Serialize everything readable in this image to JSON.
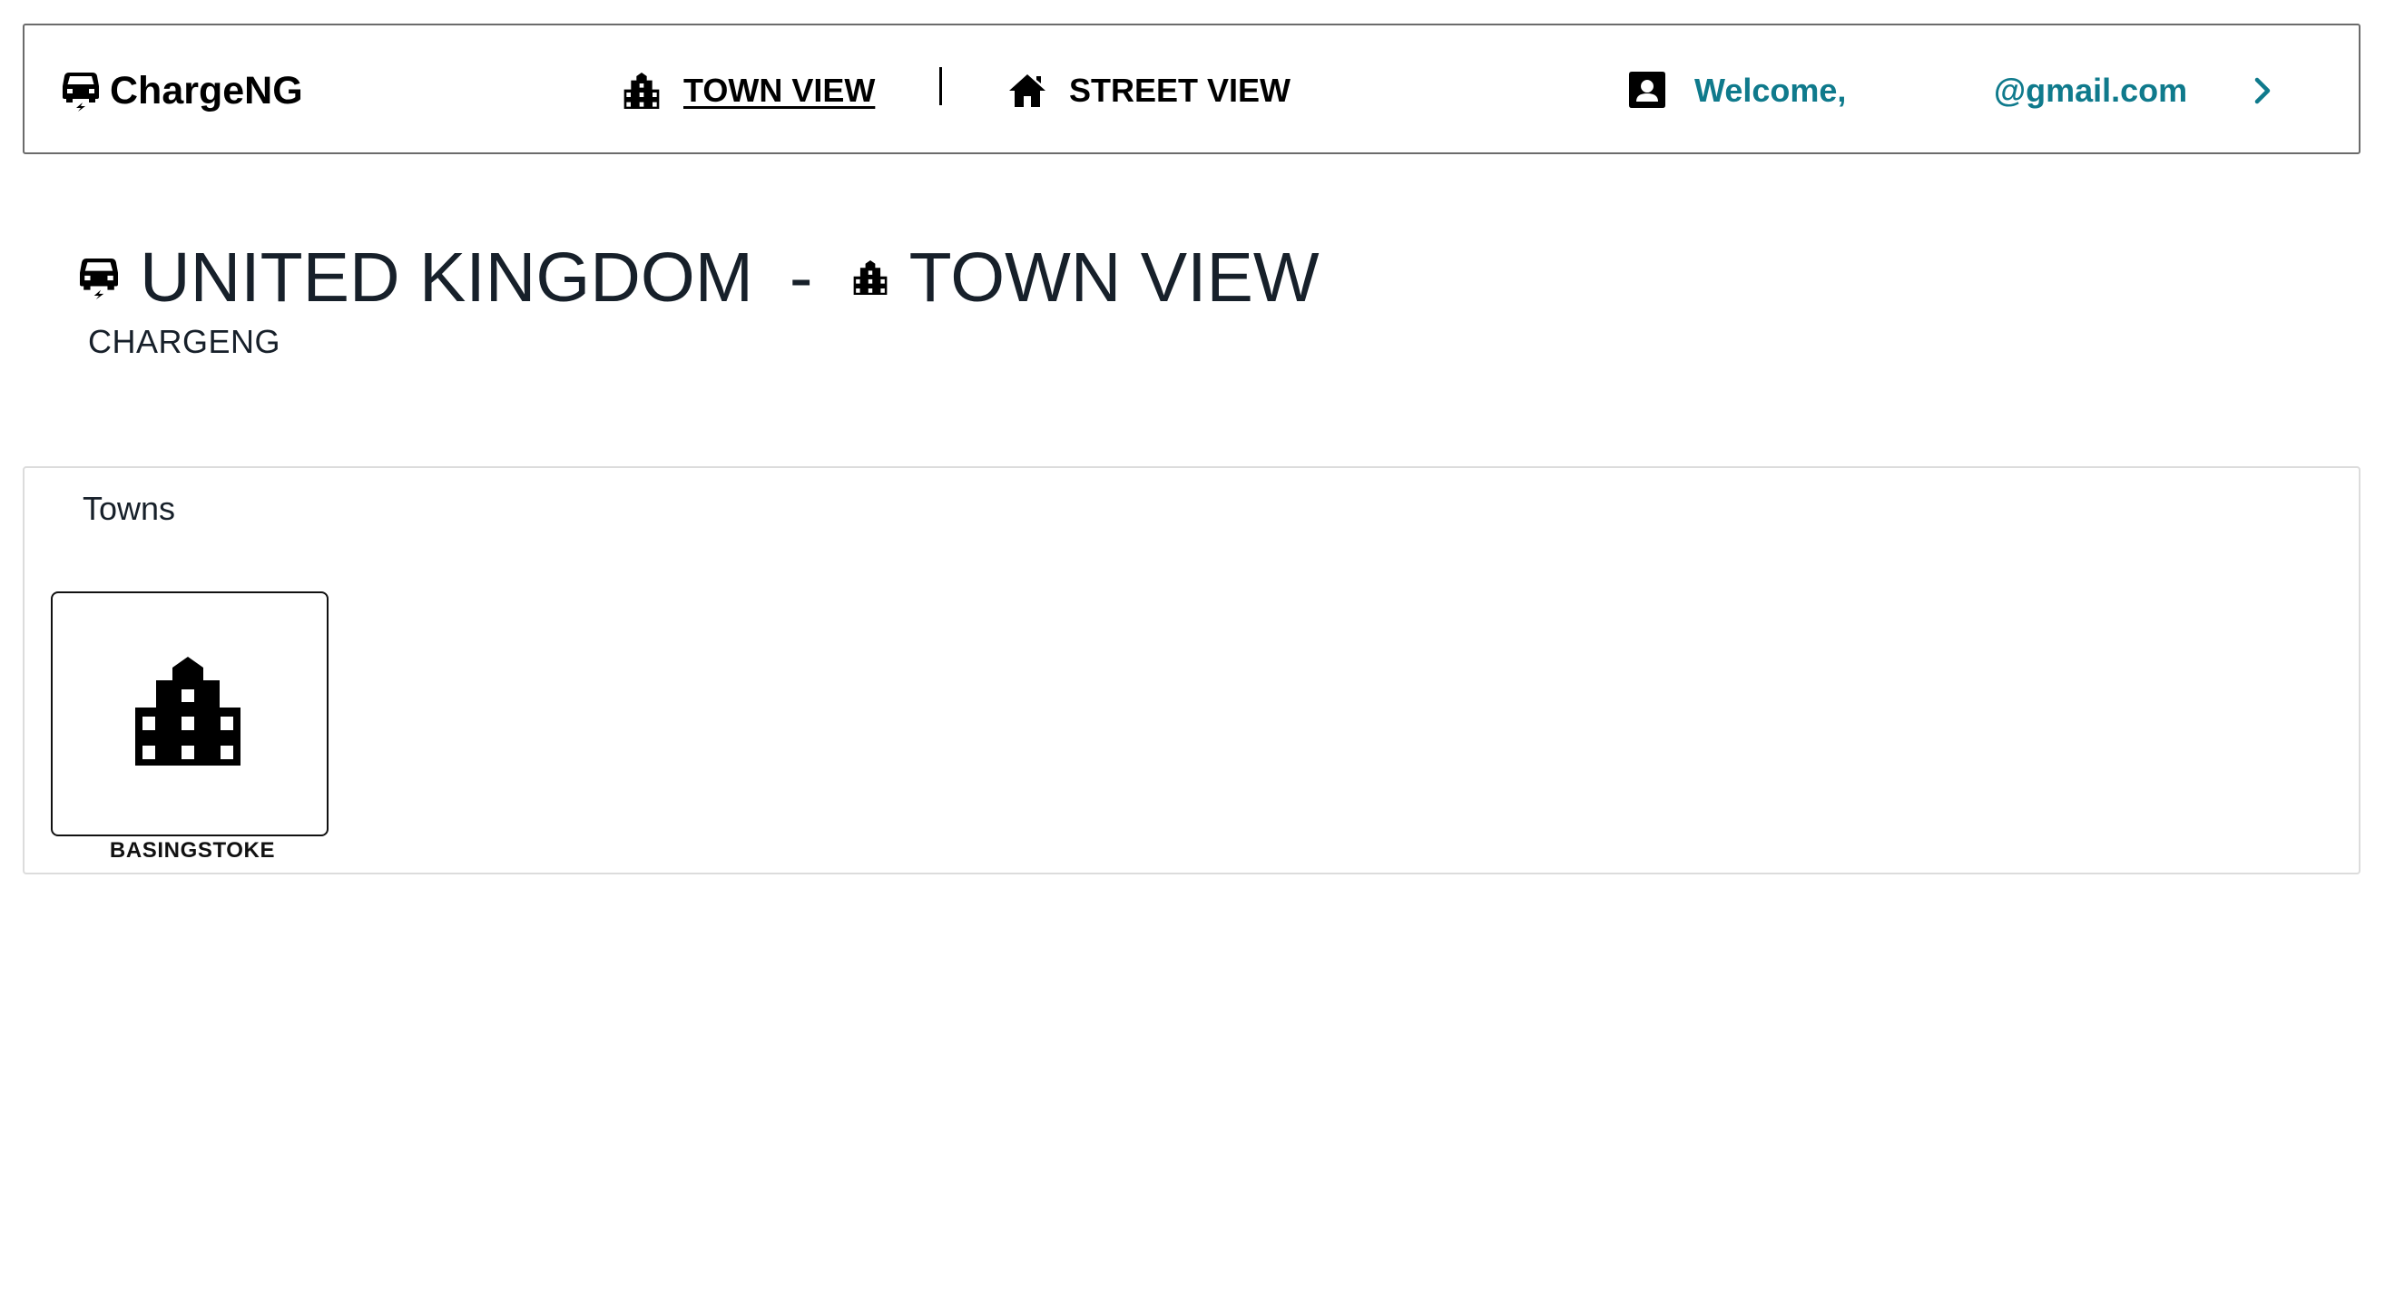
{
  "navbar": {
    "brand": "ChargeNG",
    "brand_icon": "car-charging-icon",
    "links": [
      {
        "label": "TOWN VIEW",
        "icon": "city-icon",
        "active": true
      },
      {
        "label": "STREET VIEW",
        "icon": "home-icon",
        "active": false
      }
    ],
    "user": {
      "icon": "contact-card-icon",
      "welcome": "Welcome,",
      "email": "@gmail.com",
      "chevron_icon": "chevron-right-icon"
    },
    "accent_color": "#0f7a8c"
  },
  "heading": {
    "country": "UNITED KINGDOM",
    "separator": "-",
    "view": "TOWN VIEW",
    "subtitle": "CHARGENG"
  },
  "towns": {
    "title": "Towns",
    "items": [
      {
        "name": "BASINGSTOKE",
        "icon": "city-icon"
      }
    ]
  }
}
